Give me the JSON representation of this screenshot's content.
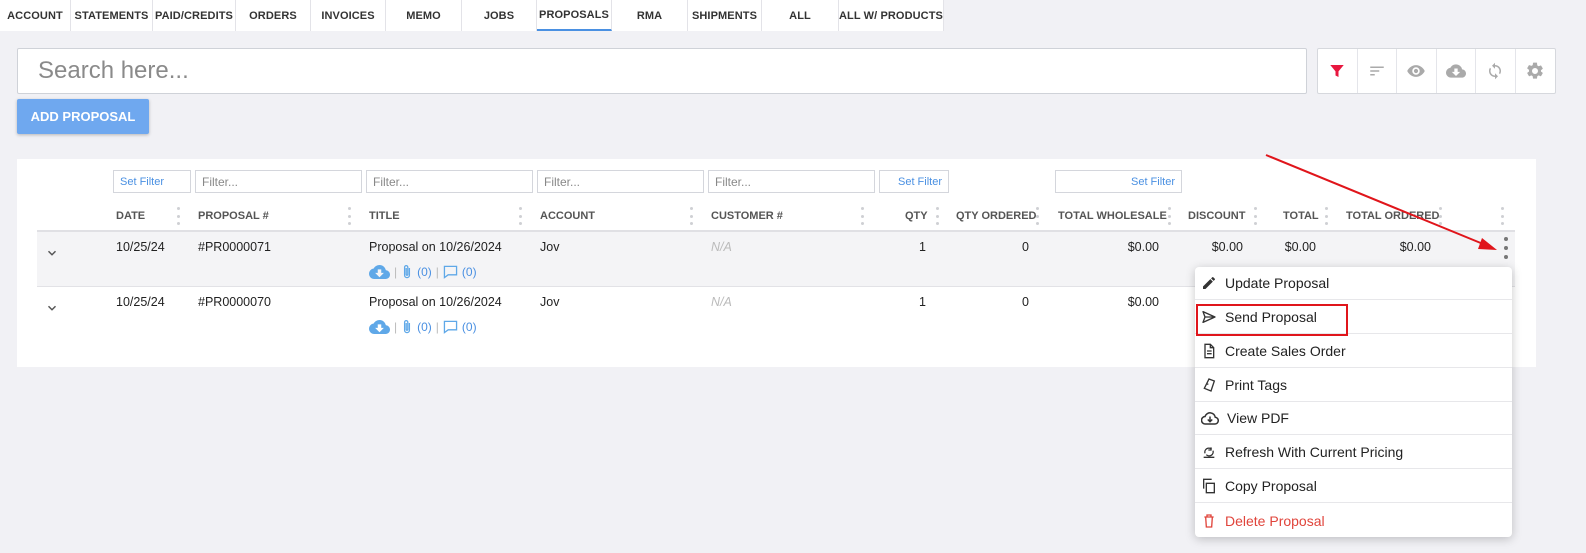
{
  "tabs": [
    {
      "label": "ACCOUNT",
      "active": false
    },
    {
      "label": "STATEMENTS",
      "active": false
    },
    {
      "label": "PAID/CREDITS",
      "active": false
    },
    {
      "label": "ORDERS",
      "active": false
    },
    {
      "label": "INVOICES",
      "active": false
    },
    {
      "label": "MEMO",
      "active": false
    },
    {
      "label": "JOBS",
      "active": false
    },
    {
      "label": "PROPOSALS",
      "active": true
    },
    {
      "label": "RMA",
      "active": false
    },
    {
      "label": "SHIPMENTS",
      "active": false
    },
    {
      "label": "ALL",
      "active": false
    },
    {
      "label": "ALL W/ PRODUCTS",
      "active": false
    }
  ],
  "search": {
    "placeholder": "Search here..."
  },
  "toolbar": {
    "icons": [
      "filter-icon",
      "sort-icon",
      "eye-icon",
      "cloud-download-icon",
      "sync-icon",
      "gear-icon"
    ],
    "accent": "#e8173f"
  },
  "add_button": {
    "label": "ADD PROPOSAL"
  },
  "filters": {
    "set_filter": "Set Filter",
    "placeholder": "Filter..."
  },
  "columns": [
    "DATE",
    "PROPOSAL #",
    "TITLE",
    "ACCOUNT",
    "CUSTOMER #",
    "QTY",
    "QTY ORDERED",
    "TOTAL WHOLESALE",
    "DISCOUNT",
    "TOTAL",
    "TOTAL ORDERED"
  ],
  "rows": [
    {
      "date": "10/25/24",
      "proposal": "#PR0000071",
      "title": "Proposal on 10/26/2024",
      "account": "Jov",
      "customer": "N/A",
      "qty": "1",
      "qty_ordered": "0",
      "total_wholesale": "$0.00",
      "discount": "$0.00",
      "total": "$0.00",
      "total_ordered": "$0.00",
      "attachments": "(0)",
      "comments": "(0)"
    },
    {
      "date": "10/25/24",
      "proposal": "#PR0000070",
      "title": "Proposal on 10/26/2024",
      "account": "Jov",
      "customer": "N/A",
      "qty": "1",
      "qty_ordered": "0",
      "total_wholesale": "$0.00",
      "attachments": "(0)",
      "comments": "(0)"
    }
  ],
  "menu": {
    "items": [
      {
        "label": "Update Proposal",
        "icon": "pencil-icon"
      },
      {
        "label": "Send Proposal",
        "icon": "send-icon"
      },
      {
        "label": "Create Sales Order",
        "icon": "document-icon"
      },
      {
        "label": "Print Tags",
        "icon": "tags-icon"
      },
      {
        "label": "View PDF",
        "icon": "cloud-download-icon"
      },
      {
        "label": "Refresh With Current Pricing",
        "icon": "price-refresh-icon"
      },
      {
        "label": "Copy Proposal",
        "icon": "copy-icon"
      },
      {
        "label": "Delete Proposal",
        "icon": "trash-icon"
      }
    ],
    "danger_color": "#e0443b"
  },
  "annotation_color": "#e0151b"
}
